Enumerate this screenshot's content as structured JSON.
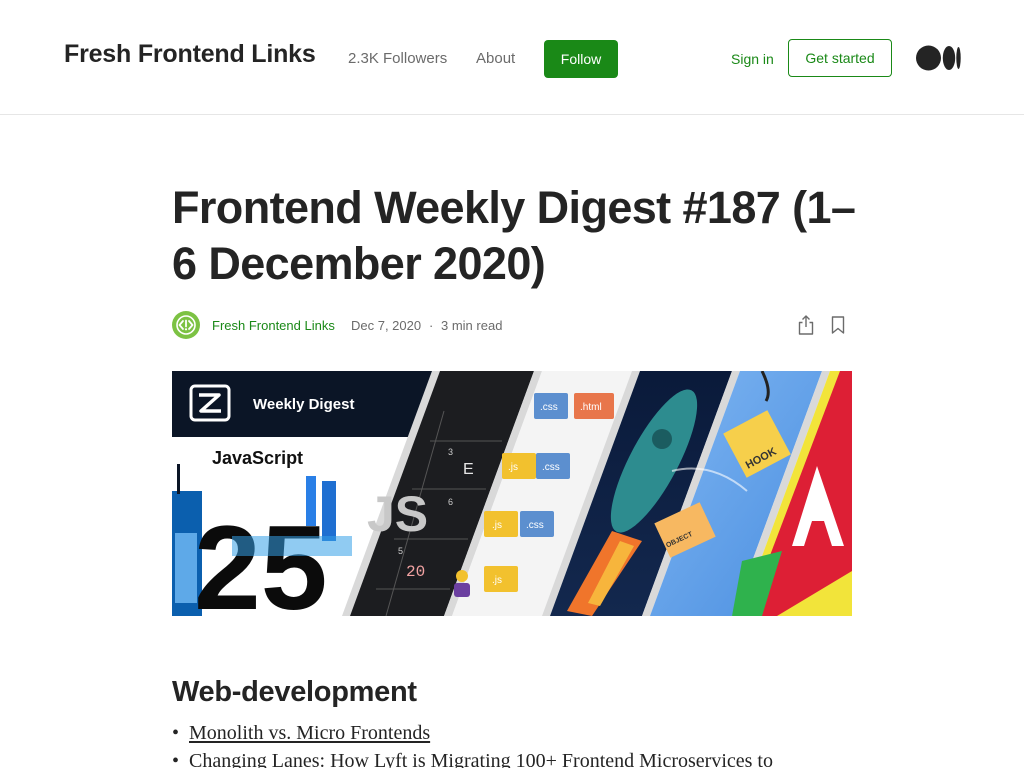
{
  "header": {
    "publication": "Fresh Frontend Links",
    "followers": "2.3K Followers",
    "about": "About",
    "follow": "Follow",
    "sign_in": "Sign in",
    "get_started": "Get started"
  },
  "article": {
    "title": "Frontend Weekly Digest #187 (1–6 December 2020)",
    "author": "Fresh Frontend Links",
    "date": "Dec 7, 2020",
    "separator": "·",
    "read_time": "3 min read",
    "hero": {
      "weekly_digest": "Weekly Digest",
      "javascript": "JavaScript",
      "number": "25",
      "js": "JS",
      "e": "E",
      "twenty": "20",
      "grid_digits": [
        "3",
        "6",
        "5"
      ],
      "css1": ".css",
      "html": ".html",
      "css2": ".css",
      "css3": ".css",
      "js1": ".js",
      "js2": ".js",
      "js3": ".js",
      "hook": "HOOK",
      "object": "OBJECT"
    },
    "section_heading": "Web-development",
    "bullet": "•",
    "links": [
      "Monolith vs. Micro Frontends",
      "Changing Lanes: How Lyft is Migrating 100+ Frontend Microservices to"
    ]
  },
  "colors": {
    "accent": "#1a8917",
    "text": "#242424",
    "muted": "#6b6b6b",
    "avatar": "#7cc243"
  }
}
